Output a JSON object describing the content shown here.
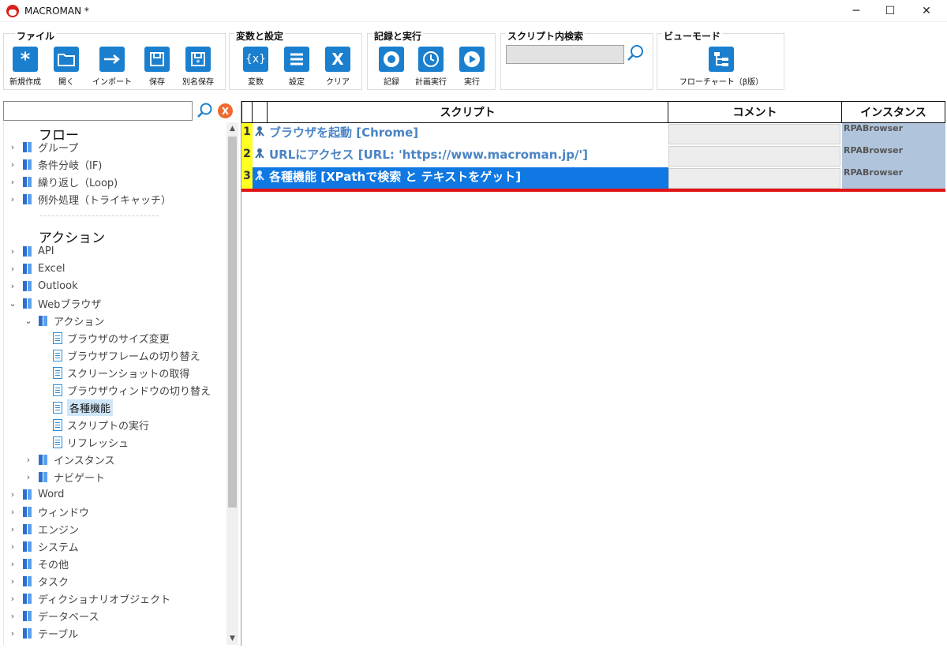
{
  "window": {
    "title": "MACROMAN *",
    "controls": {
      "minimize": "─",
      "maximize": "☐",
      "close": "✕"
    }
  },
  "ribbon": {
    "file": {
      "title": "ファイル",
      "buttons": [
        {
          "label": "新規作成",
          "icon": "star-icon"
        },
        {
          "label": "開く",
          "icon": "folder-icon"
        },
        {
          "label": "インポート",
          "icon": "import-arrow-icon"
        },
        {
          "label": "保存",
          "icon": "save-icon"
        },
        {
          "label": "別名保存",
          "icon": "save-as-icon"
        }
      ]
    },
    "vars": {
      "title": "変数と設定",
      "buttons": [
        {
          "label": "変数",
          "icon": "variable-icon",
          "glyph": "{x}"
        },
        {
          "label": "設定",
          "icon": "settings-list-icon"
        },
        {
          "label": "クリア",
          "icon": "clear-icon",
          "glyph": "X"
        }
      ]
    },
    "record": {
      "title": "記録と実行",
      "buttons": [
        {
          "label": "記録",
          "icon": "record-icon"
        },
        {
          "label": "計画実行",
          "icon": "schedule-icon"
        },
        {
          "label": "実行",
          "icon": "play-icon"
        }
      ]
    },
    "search": {
      "title": "スクリプト内検索",
      "value": ""
    },
    "view": {
      "title": "ビューモード",
      "buttons": [
        {
          "label": "フローチャート（β版）",
          "icon": "flowchart-icon"
        }
      ]
    }
  },
  "left_panel": {
    "search_value": "",
    "clear_glyph": "X",
    "flow_title": "フロー",
    "flow_items": [
      "グループ",
      "条件分岐（IF)",
      "繰り返し（Loop)",
      "例外処理（トライキャッチ）"
    ],
    "action_title": "アクション",
    "action_items_top": [
      "API",
      "Excel",
      "Outlook",
      "Webブラウザ"
    ],
    "web_action_folder": "アクション",
    "web_actions": [
      "ブラウザのサイズ変更",
      "ブラウザフレームの切り替え",
      "スクリーンショットの取得",
      "ブラウザウィンドウの切り替え",
      "各種機能",
      "スクリプトの実行",
      "リフレッシュ"
    ],
    "web_subfolders": [
      "インスタンス",
      "ナビゲート"
    ],
    "action_items_bottom": [
      "Word",
      "ウィンドウ",
      "エンジン",
      "システム",
      "その他",
      "タスク",
      "ディクショナリオブジェクト",
      "データベース",
      "テーブル"
    ],
    "selected_item": "各種機能"
  },
  "grid": {
    "headers": {
      "script": "スクリプト",
      "comment": "コメント",
      "instance": "インスタンス"
    },
    "rows": [
      {
        "num": "1",
        "script": "ブラウザを起動 [Chrome]",
        "comment": "",
        "instance": "RPABrowser",
        "selected": false
      },
      {
        "num": "2",
        "script": "URLにアクセス [URL: 'https://www.macroman.jp/']",
        "comment": "",
        "instance": "RPABrowser",
        "selected": false
      },
      {
        "num": "3",
        "script": "各種機能 [XPathで検索 と テキストをゲット]",
        "comment": "",
        "instance": "RPABrowser",
        "selected": true
      }
    ]
  },
  "colors": {
    "accent": "#1a7fce",
    "selected_row": "#0f78e2",
    "row_number_bg": "#ffff20",
    "instance_bg": "#b0c4dc",
    "insertion_line": "#e21313"
  }
}
